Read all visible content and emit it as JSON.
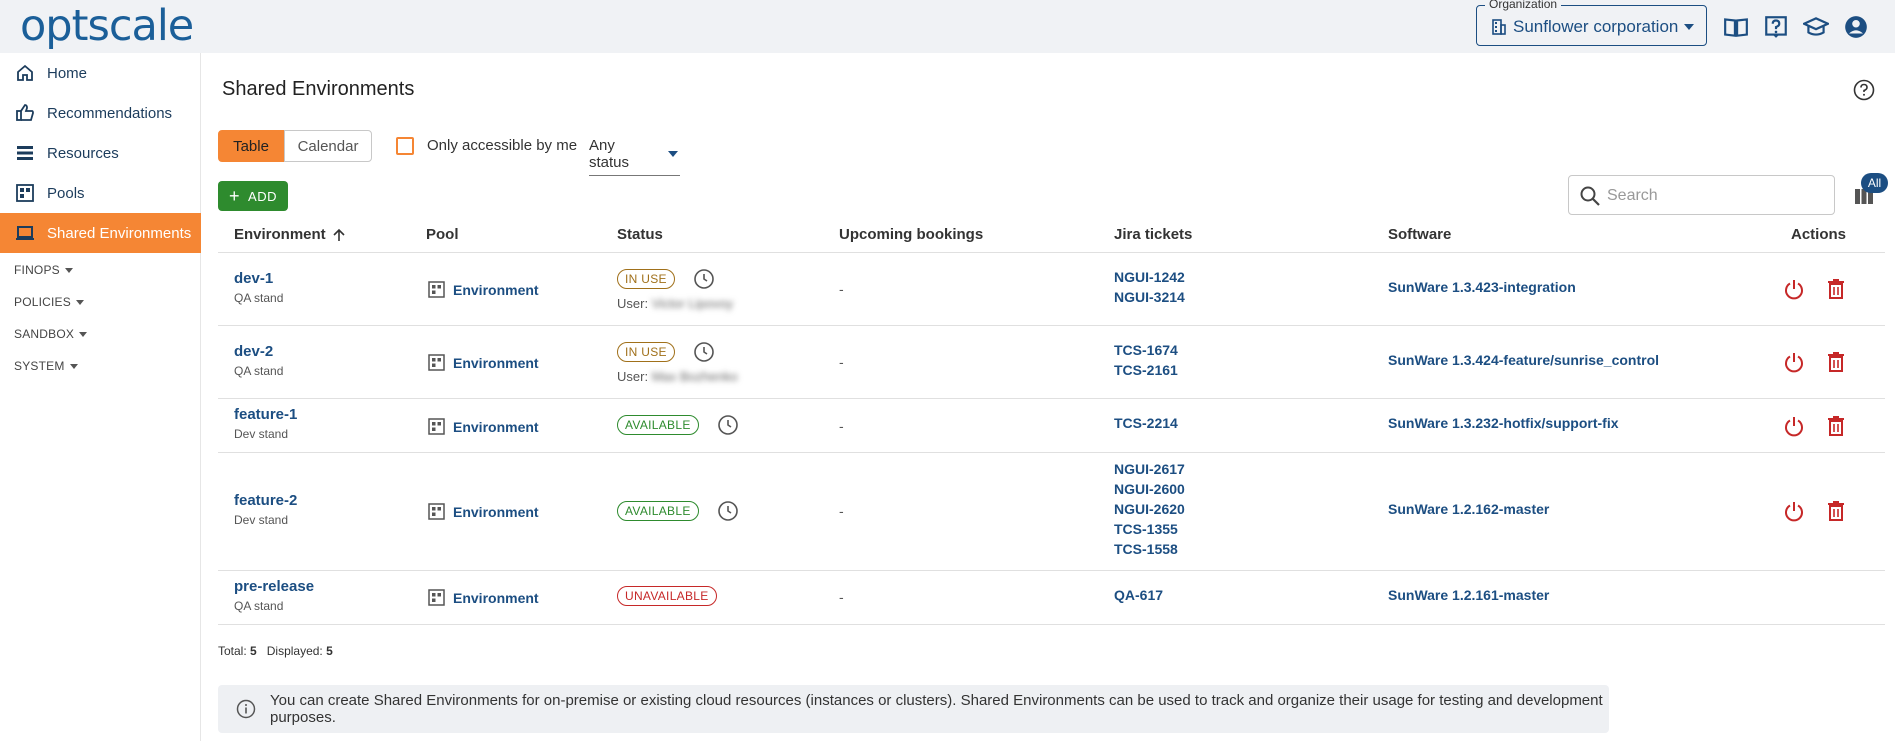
{
  "app": {
    "logo": "optscale"
  },
  "org": {
    "label": "Organization",
    "name": "Sunflower corporation"
  },
  "top_icons": [
    "documentation-icon",
    "help-icon",
    "graduation-cap-icon",
    "account-icon"
  ],
  "sidebar": {
    "items": [
      {
        "label": "Home",
        "icon": "home-icon"
      },
      {
        "label": "Recommendations",
        "icon": "thumb-up-icon"
      },
      {
        "label": "Resources",
        "icon": "list-icon"
      },
      {
        "label": "Pools",
        "icon": "pool-icon"
      },
      {
        "label": "Shared Environments",
        "icon": "laptop-icon",
        "active": true
      }
    ],
    "groups": [
      "FINOPS",
      "POLICIES",
      "SANDBOX",
      "SYSTEM"
    ]
  },
  "page": {
    "title": "Shared Environments"
  },
  "toolbar": {
    "tabs": [
      "Table",
      "Calendar"
    ],
    "active_tab": "Table",
    "checkbox_label": "Only accessible by me",
    "status_filter": "Any status",
    "add_label": "ADD",
    "search_placeholder": "Search",
    "columns_badge": "All"
  },
  "table": {
    "headers": [
      "Environment",
      "Pool",
      "Status",
      "Upcoming bookings",
      "Jira tickets",
      "Software",
      "Actions"
    ],
    "rows": [
      {
        "name": "dev-1",
        "sub": "QA stand",
        "pool": "Environment",
        "status": "IN USE",
        "user_label": "User:",
        "user": "Victor Lipovoy",
        "bookings": "-",
        "jira": [
          "NGUI-1242",
          "NGUI-3214"
        ],
        "software": "SunWare 1.3.423-integration"
      },
      {
        "name": "dev-2",
        "sub": "QA stand",
        "pool": "Environment",
        "status": "IN USE",
        "user_label": "User:",
        "user": "Max Bozhenko",
        "bookings": "-",
        "jira": [
          "TCS-1674",
          "TCS-2161"
        ],
        "software": "SunWare 1.3.424-feature/sunrise_control"
      },
      {
        "name": "feature-1",
        "sub": "Dev stand",
        "pool": "Environment",
        "status": "AVAILABLE",
        "bookings": "-",
        "jira": [
          "TCS-2214"
        ],
        "software": "SunWare 1.3.232-hotfix/support-fix"
      },
      {
        "name": "feature-2",
        "sub": "Dev stand",
        "pool": "Environment",
        "status": "AVAILABLE",
        "bookings": "-",
        "jira": [
          "NGUI-2617",
          "NGUI-2600",
          "NGUI-2620",
          "TCS-1355",
          "TCS-1558"
        ],
        "software": "SunWare 1.2.162-master"
      },
      {
        "name": "pre-release",
        "sub": "QA stand",
        "pool": "Environment",
        "status": "UNAVAILABLE",
        "bookings": "-",
        "jira": [
          "QA-617"
        ],
        "software": "SunWare 1.2.161-master"
      }
    ]
  },
  "footer": {
    "total_label": "Total:",
    "total": "5",
    "displayed_label": "Displayed:",
    "displayed": "5"
  },
  "info": {
    "text": "You can create Shared Environments for on-premise or existing cloud resources (instances or clusters). Shared Environments can be used to track and organize their usage for testing and development purposes."
  },
  "colors": {
    "accent": "#f58634",
    "primary": "#1c4e82",
    "success": "#2e8b2e",
    "danger": "#c62828",
    "warning": "#a0701a"
  }
}
